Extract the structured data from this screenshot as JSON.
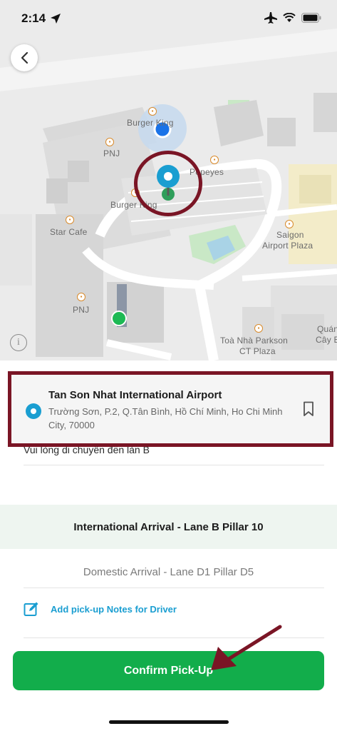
{
  "status_bar": {
    "time": "2:14"
  },
  "map": {
    "labels": {
      "burger_king_top": "Burger King",
      "pnj_top": "PNJ",
      "popeyes": "Popeyes",
      "burger_king_mid": "Burger King",
      "star_cafe": "Star Cafe",
      "saigon_airport_plaza_1": "Saigon",
      "saigon_airport_plaza_2": "Airport Plaza",
      "pnj_bottom": "PNJ",
      "parkson_1": "Toà Nhà Parkson",
      "parkson_2": "CT Plaza",
      "quan_1": "Quán",
      "quan_2": "Cây Bu"
    },
    "info_glyph": "i"
  },
  "location": {
    "title": "Tan Son Nhat International Airport",
    "address": "Trường Sơn, P.2, Q.Tân Bình, Hồ Chí Minh, Ho Chi Minh City, 70000"
  },
  "note": "Vui lòng di chuyển đến làn B",
  "pickup_points": {
    "selected": "International Arrival - Lane B Pillar 10",
    "other": "Domestic Arrival - Lane D1 Pillar D5"
  },
  "notes_action": {
    "label": "Add pick-up Notes for Driver"
  },
  "confirm": {
    "label": "Confirm Pick-Up"
  },
  "colors": {
    "brand_green": "#12ad4b",
    "pin_blue": "#1a9ed1",
    "annotation_red": "#7a1525",
    "selected_bg": "#eef5f0"
  }
}
